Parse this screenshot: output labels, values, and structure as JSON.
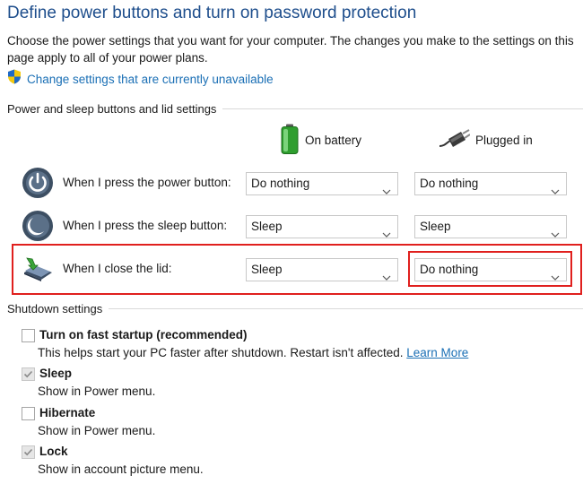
{
  "header": {
    "title": "Define power buttons and turn on password protection",
    "description": "Choose the power settings that you want for your computer. The changes you make to the settings on this page apply to all of your power plans.",
    "change_link": "Change settings that are currently unavailable"
  },
  "buttons_section": {
    "title": "Power and sleep buttons and lid settings",
    "columns": {
      "battery": "On battery",
      "plugged": "Plugged in"
    },
    "rows": [
      {
        "label": "When I press the power button:",
        "battery": "Do nothing",
        "plugged": "Do nothing",
        "icon": "power-icon"
      },
      {
        "label": "When I press the sleep button:",
        "battery": "Sleep",
        "plugged": "Sleep",
        "icon": "sleep-icon"
      },
      {
        "label": "When I close the lid:",
        "battery": "Sleep",
        "plugged": "Do nothing",
        "icon": "laptop-lid-icon"
      }
    ]
  },
  "shutdown_section": {
    "title": "Shutdown settings",
    "options": [
      {
        "label": "Turn on fast startup (recommended)",
        "checked": false,
        "description": "This helps start your PC faster after shutdown. Restart isn't affected.",
        "link": "Learn More"
      },
      {
        "label": "Sleep",
        "checked": true,
        "description": "Show in Power menu."
      },
      {
        "label": "Hibernate",
        "checked": false,
        "description": "Show in Power menu."
      },
      {
        "label": "Lock",
        "checked": true,
        "description": "Show in account picture menu."
      }
    ]
  },
  "colors": {
    "title": "#1e4e8c",
    "link": "#1a6fb5",
    "highlight": "#e0201e"
  }
}
